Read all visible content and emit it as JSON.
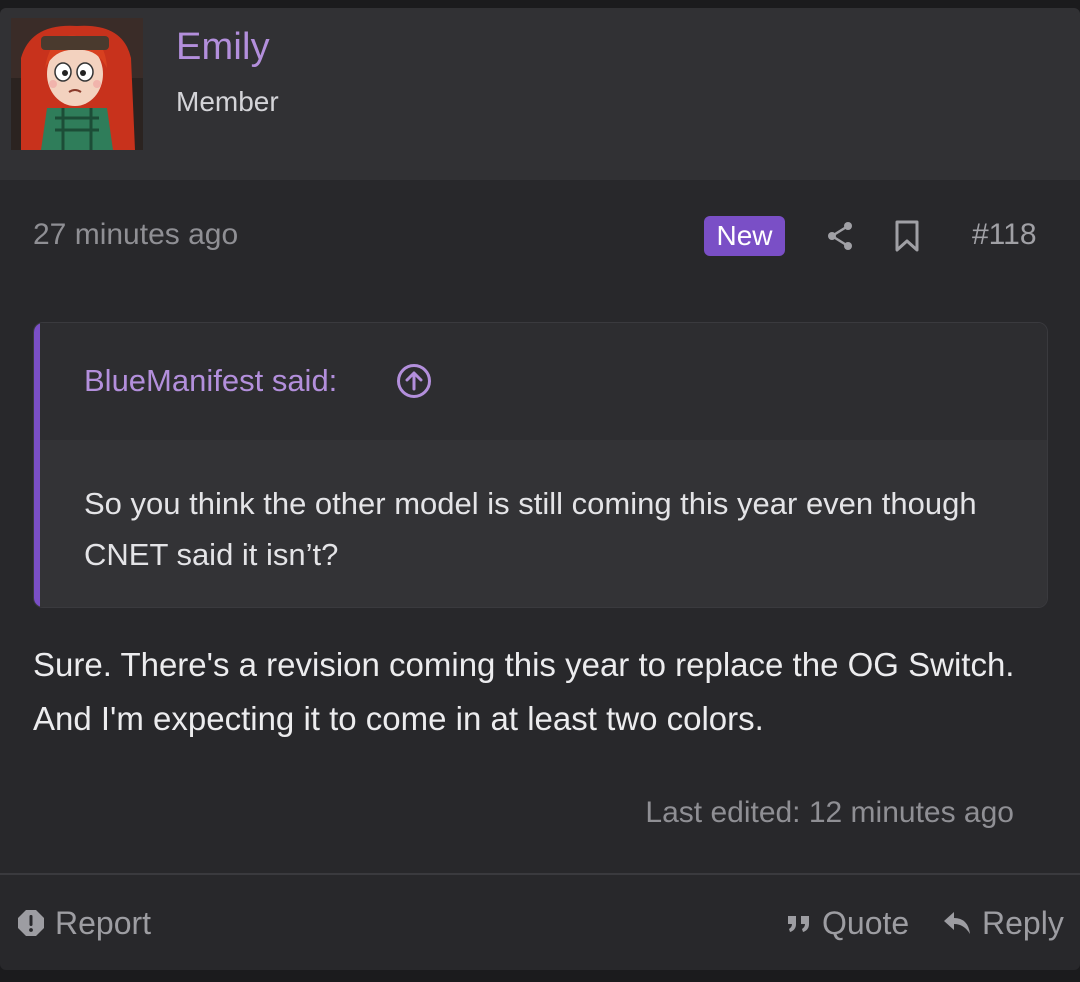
{
  "user": {
    "name": "Emily",
    "title": "Member"
  },
  "post": {
    "timestamp": "27 minutes ago",
    "badge": "New",
    "number": "#118",
    "share_icon": "share-icon",
    "bookmark_icon": "bookmark-icon",
    "quote": {
      "author_label": "BlueManifest said:",
      "jump_icon": "arrow-up-circle-icon",
      "text": "So you think the other model is still coming this year even though CNET said it isn’t?"
    },
    "message": "Sure. There's a revision coming this year to replace the OG Switch. And I'm expecting it to come in at least two colors.",
    "last_edited": "Last edited: 12 minutes ago"
  },
  "actions": {
    "report": "Report",
    "quote": "Quote",
    "reply": "Reply"
  },
  "colors": {
    "accent": "#7a4fc6",
    "username": "#b38fdc",
    "background": "#28282b"
  }
}
